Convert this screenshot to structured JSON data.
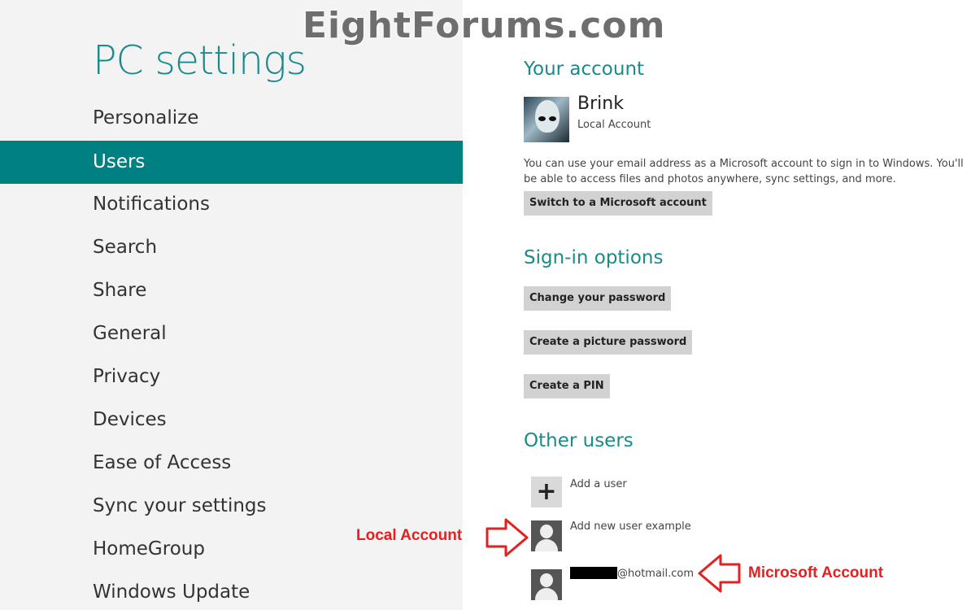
{
  "watermark": "EightForums.com",
  "left_panel": {
    "title": "PC settings",
    "nav_items": [
      {
        "label": "Personalize"
      },
      {
        "label": "Users",
        "active": true
      },
      {
        "label": "Notifications"
      },
      {
        "label": "Search"
      },
      {
        "label": "Share"
      },
      {
        "label": "General"
      },
      {
        "label": "Privacy"
      },
      {
        "label": "Devices"
      },
      {
        "label": "Ease of Access"
      },
      {
        "label": "Sync your settings"
      },
      {
        "label": "HomeGroup"
      },
      {
        "label": "Windows Update"
      }
    ]
  },
  "your_account": {
    "heading": "Your account",
    "user_name": "Brink",
    "account_type": "Local Account",
    "description": "You can use your email address as a Microsoft account to sign in to Windows. You'll be able to access files and photos anywhere, sync settings, and more.",
    "switch_button": "Switch to a Microsoft account"
  },
  "sign_in_options": {
    "heading": "Sign-in options",
    "buttons": [
      "Change your password",
      "Create a picture password",
      "Create a PIN"
    ]
  },
  "other_users": {
    "heading": "Other users",
    "add_user_label": "Add a user",
    "users": [
      {
        "label": "Add new user example"
      },
      {
        "label": "@hotmail.com"
      }
    ]
  },
  "annotations": {
    "local": "Local Account",
    "microsoft": "Microsoft Account",
    "color": "#e32121"
  },
  "colors": {
    "accent": "#008080",
    "heading": "#1a8a8a",
    "left_bg": "#f3f3f3"
  }
}
